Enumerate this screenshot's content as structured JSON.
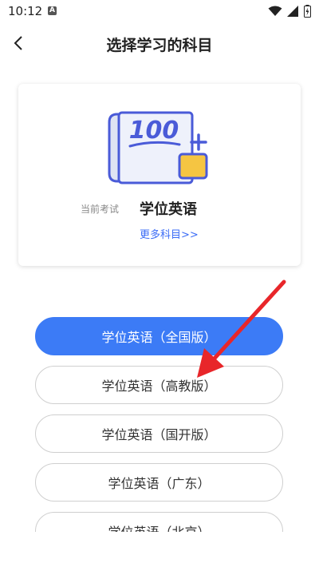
{
  "status": {
    "time": "10:12",
    "notification_letter": "A"
  },
  "header": {
    "title": "选择学习的科目"
  },
  "exam": {
    "current_label": "当前考试",
    "current_value": "学位英语",
    "more_link": "更多科目>>",
    "score_text": "100"
  },
  "subjects": [
    {
      "label": "学位英语（全国版）",
      "selected": true
    },
    {
      "label": "学位英语（高教版）",
      "selected": false
    },
    {
      "label": "学位英语（国开版）",
      "selected": false
    },
    {
      "label": "学位英语（广东）",
      "selected": false
    },
    {
      "label": "学位英语（北京）",
      "selected": false
    }
  ],
  "colors": {
    "accent": "#3c7bf6",
    "link": "#3b6cf6",
    "annotation_arrow": "#e8262a",
    "icon_yellow": "#f5c542"
  }
}
